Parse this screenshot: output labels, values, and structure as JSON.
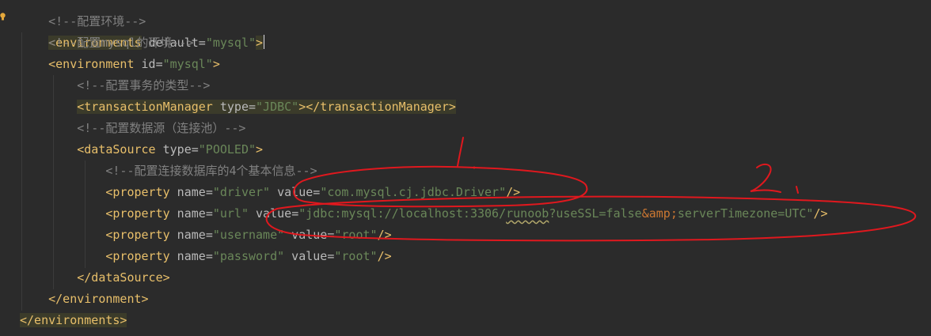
{
  "code": {
    "line0": {
      "comment": "<!--配置环境-->"
    },
    "line1": {
      "open": "<environments",
      "attr": " default",
      "eq": "=",
      "val": "\"mysql\"",
      "close": ">"
    },
    "line2": {
      "comment": "<!--配置mysql的环境-->"
    },
    "line3": {
      "open": "<environment",
      "attr": " id",
      "eq": "=",
      "val": "\"mysql\"",
      "close": ">"
    },
    "line4": {
      "comment": "<!--配置事务的类型-->"
    },
    "line5": {
      "open": "<transactionManager",
      "attr": " type",
      "eq": "=",
      "val": "\"JDBC\"",
      "close": "></transactionManager>"
    },
    "line6": {
      "comment": "<!--配置数据源（连接池）-->"
    },
    "line7": {
      "open": "<dataSource",
      "attr": " type",
      "eq": "=",
      "val": "\"POOLED\"",
      "close": ">"
    },
    "line8": {
      "comment": "<!--配置连接数据库的4个基本信息-->"
    },
    "line9": {
      "open": "<property",
      "attr1": " name",
      "eq": "=",
      "val1": "\"driver\"",
      "attr2": " value",
      "val2": "\"com.mysql.cj.jdbc.Driver\"",
      "close": "/>"
    },
    "line10": {
      "open": "<property",
      "attr1": " name",
      "eq": "=",
      "val1": "\"url\"",
      "attr2": " value",
      "val2a": "\"jdbc:mysql://localhost:3306/",
      "val2b": "runoob",
      "val2c": "?useSSL=false",
      "entity": "&amp;",
      "val2d": "serverTimezone=UTC\"",
      "close": "/>"
    },
    "line11": {
      "open": "<property",
      "attr1": " name",
      "eq": "=",
      "val1": "\"username\"",
      "attr2": " value",
      "val2": "\"root\"",
      "close": "/>"
    },
    "line12": {
      "open": "<property",
      "attr1": " name",
      "eq": "=",
      "val1": "\"password\"",
      "attr2": " value",
      "val2": "\"root\"",
      "close": "/>"
    },
    "line13": {
      "tag": "</dataSource>"
    },
    "line14": {
      "tag": "</environment>"
    },
    "line15": {
      "tag": "</environments>"
    }
  },
  "annotations": {
    "mark1": "1.",
    "mark2": "2."
  },
  "colors": {
    "tag": "#e8bf6a",
    "attribute": "#bababa",
    "string": "#6a8759",
    "comment": "#808080",
    "annotation": "#e0181e",
    "background": "#2b2b2b"
  }
}
